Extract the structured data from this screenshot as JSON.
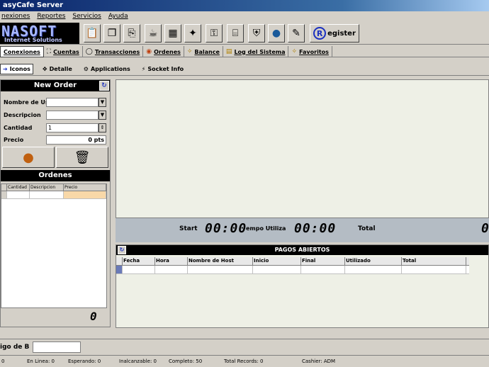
{
  "window": {
    "title": "asyCafe Server"
  },
  "menu": [
    "nexiones",
    "Reportes",
    "Servicios",
    "Ayuda"
  ],
  "logo": {
    "brand": "NASOFT",
    "tagline": "Internet Solutions"
  },
  "toolbar": {
    "icons": [
      "clipboard-icon",
      "copy-icon",
      "pages-icon",
      "coffee-icon",
      "grid-icon",
      "run-icon",
      "key-icon",
      "tray-icon",
      "lock-icon",
      "globe-icon",
      "tag-icon"
    ],
    "register_label": "egister",
    "register_glyph": "R"
  },
  "tabs1": [
    {
      "label": "Conexiones",
      "icon": "⛁",
      "active": true
    },
    {
      "label": "Cuentas",
      "icon": "⛶"
    },
    {
      "label": "Transacciones",
      "icon": "◯"
    },
    {
      "label": "Ordenes",
      "icon": "◉"
    },
    {
      "label": "Balance",
      "icon": "✧"
    },
    {
      "label": "Log del Sistema",
      "icon": "▤"
    },
    {
      "label": "Favoritos",
      "icon": "✧"
    }
  ],
  "tabs2": [
    {
      "label": "Iconos",
      "active": true
    },
    {
      "label": "Detalle"
    },
    {
      "label": "Applications"
    },
    {
      "label": "Socket Info"
    }
  ],
  "new_order": {
    "title": "New Order",
    "fields": {
      "nombre": {
        "label": "Nombre de Us",
        "value": ""
      },
      "descripcion": {
        "label": "Descripcion",
        "value": ""
      },
      "cantidad": {
        "label": "Cantidad",
        "value": "1"
      },
      "precio": {
        "label": "Precio",
        "value": "0 pts"
      }
    }
  },
  "ordenes": {
    "title": "Ordenes",
    "columns": [
      "Cantidad",
      "Descripcion",
      "Precio"
    ],
    "total": "0"
  },
  "timer": {
    "start_label": "Start",
    "start_value": "00:00",
    "tiempo_label": "empo Utiliza",
    "tiempo_value": "00:00",
    "total_label": "Total",
    "total_value": "0"
  },
  "pagos": {
    "title": "PAGOS ABIERTOS",
    "columns": [
      "Fecha",
      "Hora",
      "Nombre de Host",
      "Inicio",
      "Final",
      "Utilizado",
      "Total"
    ]
  },
  "barcode": {
    "label": "igo de B",
    "value": ""
  },
  "status": {
    "item0": "0",
    "enlinea": "En Linea: 0",
    "esperando": "Esperando: 0",
    "inalcanzable": "Inalcanzable: 0",
    "completo": "Completo: 50",
    "total_records": "Total Records: 0",
    "cashier": "Cashier: ADM"
  }
}
